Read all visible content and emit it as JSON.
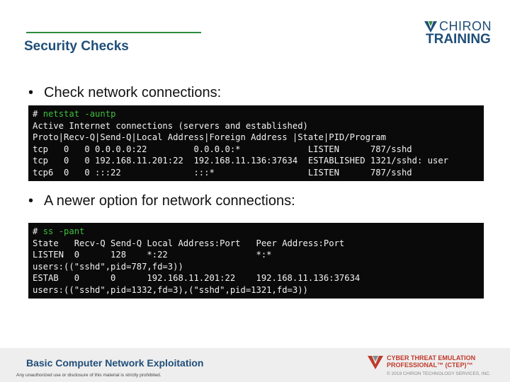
{
  "slide": {
    "title": "Security Checks"
  },
  "logo": {
    "line1": "CHIRON",
    "line2": "TRAINING"
  },
  "bullets": [
    {
      "text": "Check network connections:"
    },
    {
      "text": "A newer option for network connections:"
    }
  ],
  "code_blocks": [
    {
      "prompt": "# ",
      "command": "netstat -auntp",
      "lines": [
        "Active Internet connections (servers and established)",
        "Proto|Recv-Q|Send-Q|Local Address|Foreign Address |State|PID/Program",
        "tcp   0   0 0.0.0.0:22         0.0.0.0:*             LISTEN      787/sshd",
        "tcp   0   0 192.168.11.201:22  192.168.11.136:37634  ESTABLISHED 1321/sshd: user",
        "tcp6  0   0 :::22              :::*                  LISTEN      787/sshd"
      ]
    },
    {
      "prompt": "# ",
      "command": "ss -pant",
      "lines": [
        "State   Recv-Q Send-Q Local Address:Port   Peer Address:Port",
        "LISTEN  0      128    *:22                 *:*",
        "users:((\"sshd\",pid=787,fd=3))",
        "ESTAB   0      0      192.168.11.201:22    192.168.11.136:37634",
        "users:((\"sshd\",pid=1332,fd=3),(\"sshd\",pid=1321,fd=3))"
      ]
    }
  ],
  "footer": {
    "course_title": "Basic Computer Network Exploitation",
    "disclaimer": "Any unauthorized use or disclosure of this material is strictly prohibited.",
    "program_line1": "CYBER THREAT EMULATION",
    "program_line2": "PROFESSIONAL™ (CTEP)™",
    "copyright": "© 2019 CHIRON TECHNOLOGY SERVICES, INC."
  },
  "colors": {
    "accent_blue": "#1f4e79",
    "accent_green": "#2e8b3e",
    "accent_red": "#c0392b",
    "terminal_bg": "#0a0a0a"
  }
}
